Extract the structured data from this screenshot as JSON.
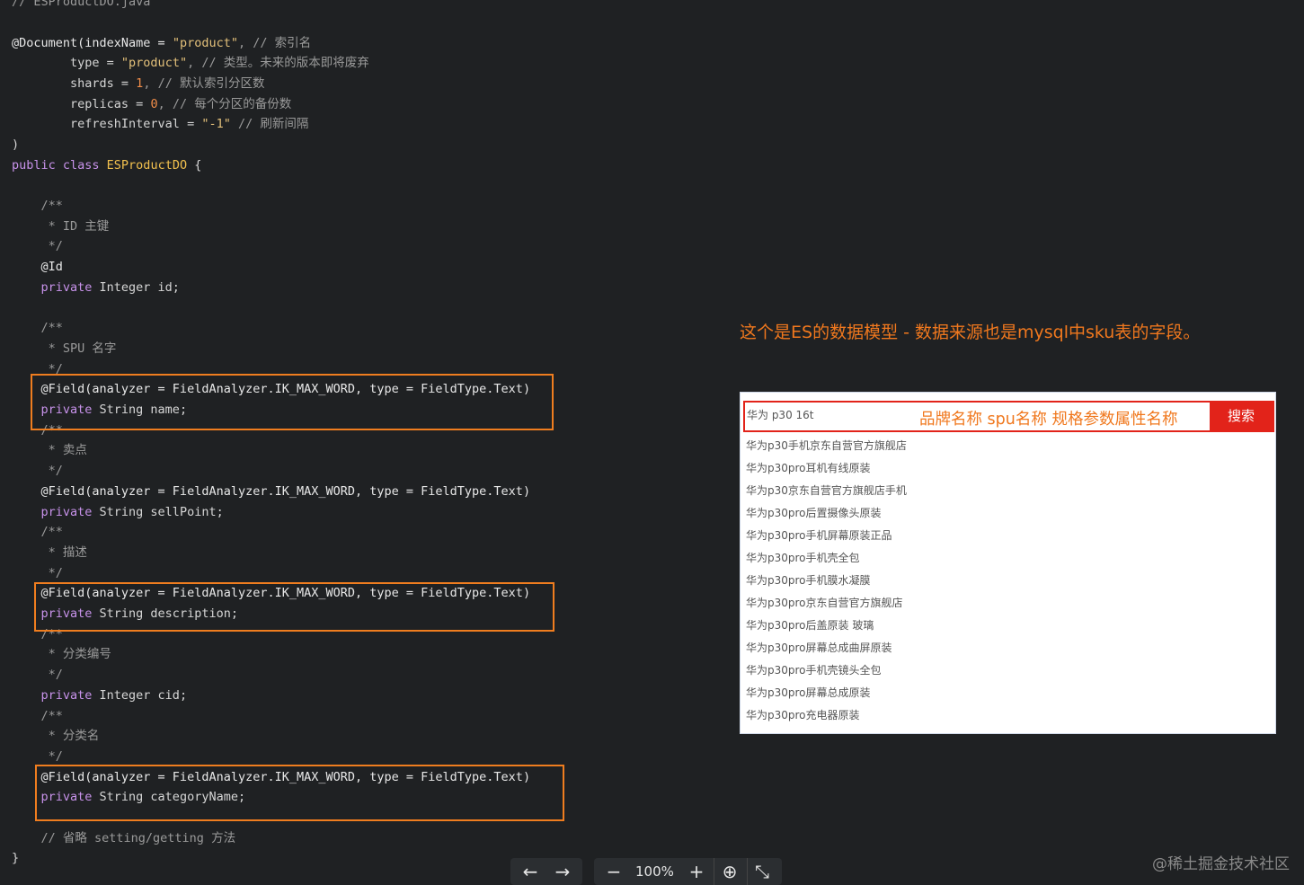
{
  "code": {
    "file_comment": "// ESProductDO.java",
    "doc_line1": "@Document(indexName = ",
    "doc_line1_str": "\"product\"",
    "doc_line1_comment": ", // 索引名",
    "type_prefix": "        type = ",
    "type_str": "\"product\"",
    "type_comment": ", // 类型。未来的版本即将废弃",
    "shards_prefix": "        shards = ",
    "shards_num": "1",
    "shards_comment": ", // 默认索引分区数",
    "replicas_prefix": "        replicas = ",
    "replicas_num": "0",
    "replicas_comment": ", // 每个分区的备份数",
    "refresh_prefix": "        refreshInterval = ",
    "refresh_str": "\"-1\"",
    "refresh_comment": " // 刷新间隔",
    "close_paren": ")",
    "class_kw": "public class ",
    "class_name": "ESProductDO",
    "class_open": " {",
    "c_open": "    /**",
    "id_doc": "     * ID 主键",
    "c_close": "     */",
    "id_ann": "    @Id",
    "id_kw": "    private",
    "id_field": " Integer id;",
    "spu_doc": "     * SPU 名字",
    "field_ann": "    @Field(analyzer = FieldAnalyzer.IK_MAX_WORD, type = FieldType.Text)",
    "name_field": " String name;",
    "sellpoint_doc": "     * 卖点",
    "sellpoint_field": " String sellPoint;",
    "desc_doc": "     * 描述",
    "desc_field": " String description;",
    "cid_doc": "     * 分类编号",
    "cid_field": " Integer cid;",
    "cname_doc": "     * 分类名",
    "cname_field": " String categoryName;",
    "omit_comment": "    // 省略 setting/getting 方法",
    "close_brace": "}"
  },
  "note": "这个是ES的数据模型 - 数据来源也是mysql中sku表的字段。",
  "search": {
    "input_value": "华为 p30 16t",
    "overlay_label": "品牌名称 spu名称 规格参数属性名称",
    "button_label": "搜索",
    "suggestions": [
      "华为p30手机京东自营官方旗舰店",
      "华为p30pro耳机有线原装",
      "华为p30京东自营官方旗舰店手机",
      "华为p30pro后置摄像头原装",
      "华为p30pro手机屏幕原装正品",
      "华为p30pro手机壳全包",
      "华为p30pro手机膜水凝膜",
      "华为p30pro京东自营官方旗舰店",
      "华为p30pro后盖原装 玻璃",
      "华为p30pro屏幕总成曲屏原装",
      "华为p30pro手机壳镜头全包",
      "华为p30pro屏幕总成原装",
      "华为p30pro充电器原装"
    ]
  },
  "toolbar": {
    "prev_icon": "←",
    "next_icon": "→",
    "zoom_out_icon": "−",
    "zoom": "100%",
    "zoom_in_icon": "+",
    "download_icon": "⊕",
    "fit_icon": "⤡"
  },
  "watermark": "@稀土掘金技术社区"
}
